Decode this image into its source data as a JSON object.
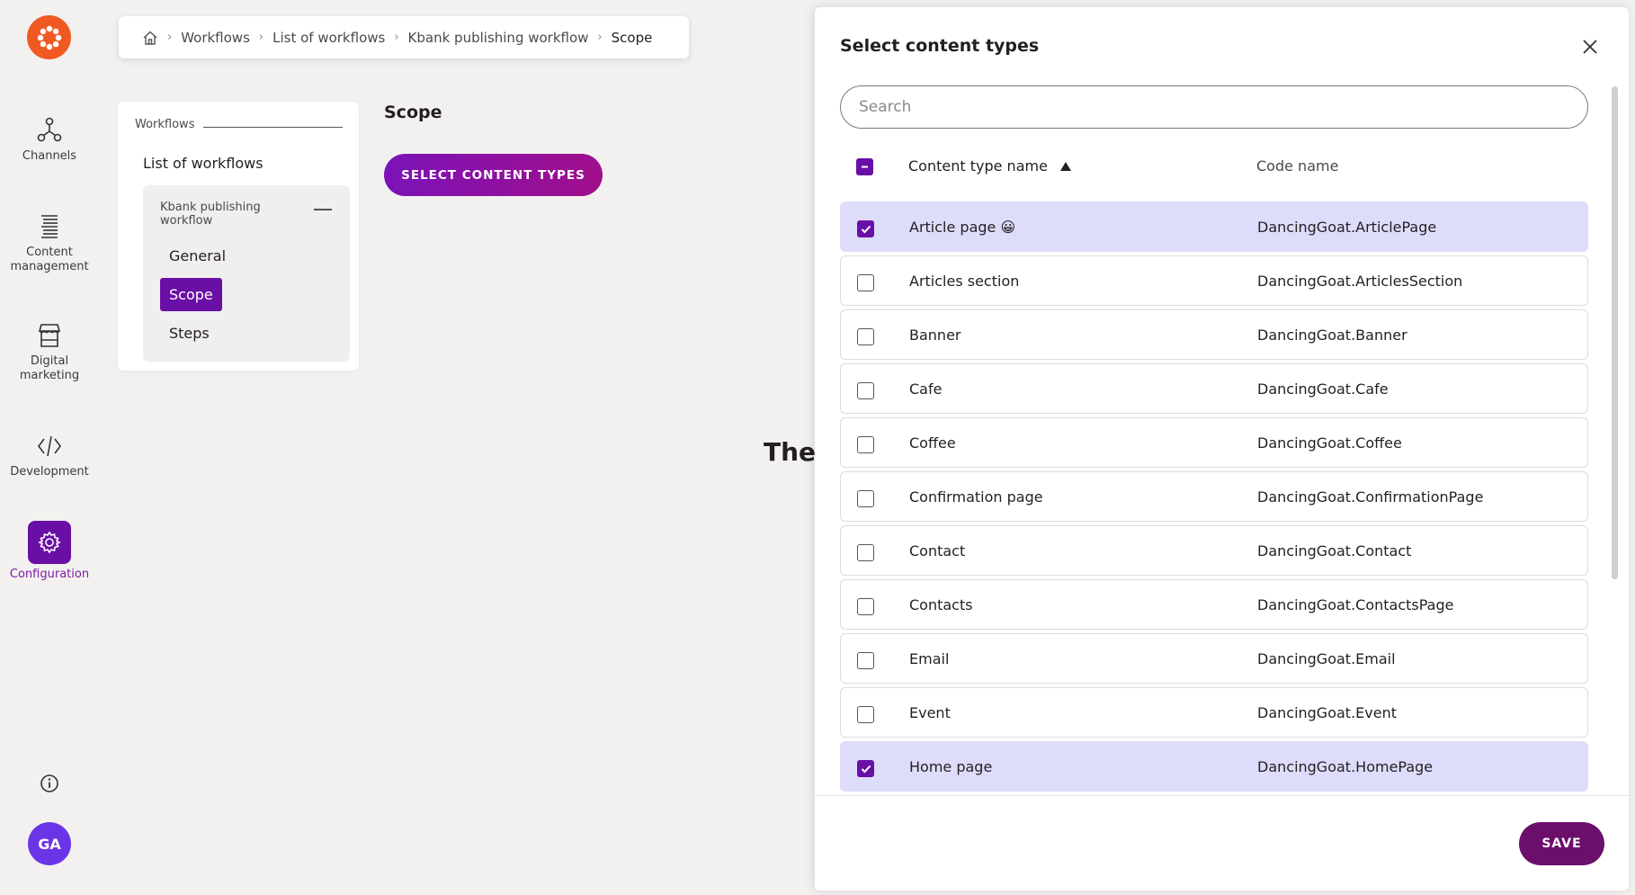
{
  "nav": {
    "items": [
      {
        "label": "Channels",
        "icon": "channels-icon"
      },
      {
        "label": "Content management",
        "icon": "content-management-icon"
      },
      {
        "label": "Digital marketing",
        "icon": "digital-marketing-icon"
      },
      {
        "label": "Development",
        "icon": "development-icon"
      },
      {
        "label": "Configuration",
        "icon": "configuration-icon",
        "active": true
      }
    ],
    "avatar": "GA",
    "accent": "#6a0fa6",
    "logo_color": "#f05a22"
  },
  "breadcrumb": {
    "items": [
      "Workflows",
      "List of workflows",
      "Kbank publishing workflow",
      "Scope"
    ]
  },
  "subnav": {
    "heading": "Workflows",
    "list_link": "List of workflows",
    "group_title": "Kbank publishing workflow",
    "items": [
      "General",
      "Scope",
      "Steps"
    ],
    "active": "Scope"
  },
  "main": {
    "title": "Scope",
    "select_button": "SELECT CONTENT TYPES",
    "empty_text": "Ther"
  },
  "dialog": {
    "title": "Select content types",
    "search_placeholder": "Search",
    "col_name": "Content type name",
    "col_code": "Code name",
    "rows": [
      {
        "name": "Article page",
        "emoji": "😀",
        "code": "DancingGoat.ArticlePage",
        "checked": true
      },
      {
        "name": "Articles section",
        "code": "DancingGoat.ArticlesSection",
        "checked": false
      },
      {
        "name": "Banner",
        "code": "DancingGoat.Banner",
        "checked": false
      },
      {
        "name": "Cafe",
        "code": "DancingGoat.Cafe",
        "checked": false
      },
      {
        "name": "Coffee",
        "code": "DancingGoat.Coffee",
        "checked": false
      },
      {
        "name": "Confirmation page",
        "code": "DancingGoat.ConfirmationPage",
        "checked": false
      },
      {
        "name": "Contact",
        "code": "DancingGoat.Contact",
        "checked": false
      },
      {
        "name": "Contacts",
        "code": "DancingGoat.ContactsPage",
        "checked": false
      },
      {
        "name": "Email",
        "code": "DancingGoat.Email",
        "checked": false
      },
      {
        "name": "Event",
        "code": "DancingGoat.Event",
        "checked": false
      },
      {
        "name": "Home page",
        "code": "DancingGoat.HomePage",
        "checked": true
      }
    ],
    "save_label": "SAVE"
  }
}
